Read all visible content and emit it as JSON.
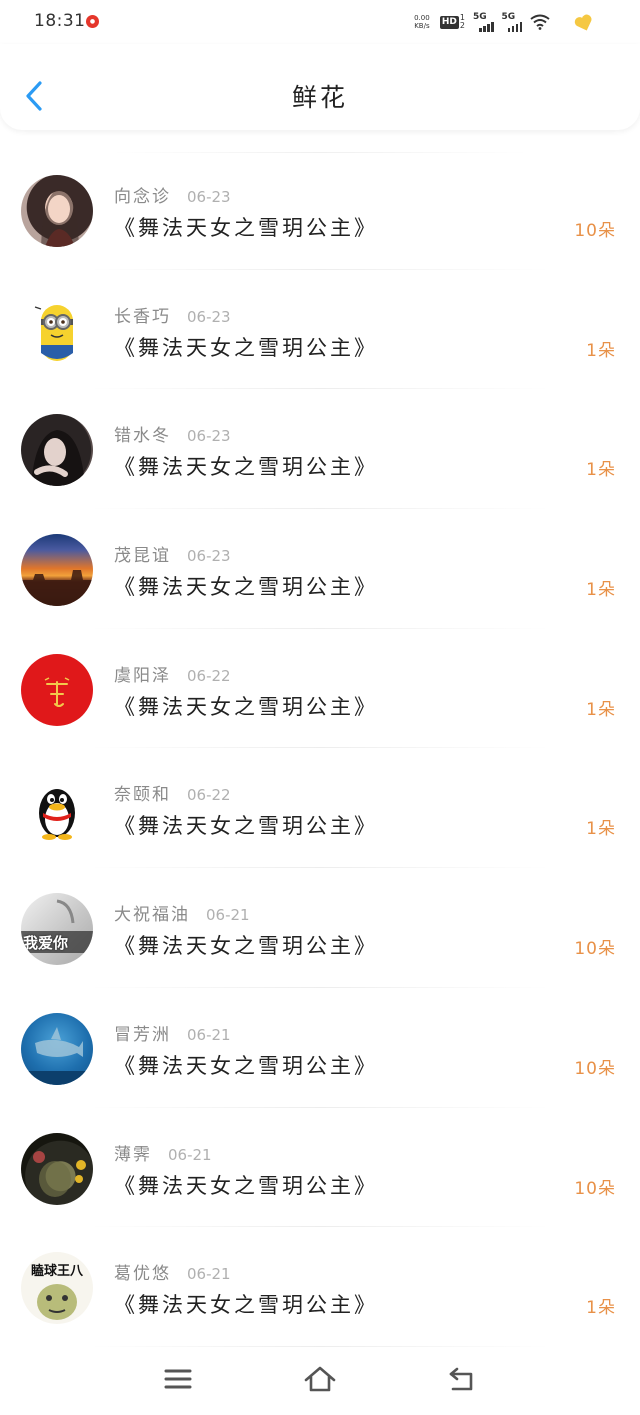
{
  "status_bar": {
    "time": "18:31",
    "speed_value": "0.00",
    "speed_unit": "KB/s",
    "hd_label": "HD",
    "hd_sup": "1",
    "hd_sub": "2",
    "network_1": "5G",
    "network_2": "5G",
    "icons": [
      "notification-badge-icon",
      "wifi-icon",
      "heart-icon"
    ]
  },
  "header": {
    "title": "鲜花",
    "back_icon": "chevron-left-icon"
  },
  "colors": {
    "accent": "#2b9bf4",
    "count": "#e89148",
    "name": "#8a8a8a",
    "date": "#b0b0b0",
    "title": "#222222"
  },
  "gifts": [
    {
      "name": "向念诊",
      "date": "06-23",
      "title": "《舞法天女之雪玥公主》",
      "count": "10朵",
      "avatar": "photo-girl"
    },
    {
      "name": "长香巧",
      "date": "06-23",
      "title": "《舞法天女之雪玥公主》",
      "count": "1朵",
      "avatar": "minion"
    },
    {
      "name": "错水冬",
      "date": "06-23",
      "title": "《舞法天女之雪玥公主》",
      "count": "1朵",
      "avatar": "photo-girl-dark"
    },
    {
      "name": "茂昆谊",
      "date": "06-23",
      "title": "《舞法天女之雪玥公主》",
      "count": "1朵",
      "avatar": "sunset"
    },
    {
      "name": "虞阳泽",
      "date": "06-22",
      "title": "《舞法天女之雪玥公主》",
      "count": "1朵",
      "avatar": "red-logo"
    },
    {
      "name": "奈颐和",
      "date": "06-22",
      "title": "《舞法天女之雪玥公主》",
      "count": "1朵",
      "avatar": "qq-penguin"
    },
    {
      "name": "大祝福油",
      "date": "06-21",
      "title": "《舞法天女之雪玥公主》",
      "count": "10朵",
      "avatar": "grey-text",
      "avatar_text": "我爱你"
    },
    {
      "name": "冒芳洲",
      "date": "06-21",
      "title": "《舞法天女之雪玥公主》",
      "count": "10朵",
      "avatar": "shark"
    },
    {
      "name": "薄霁",
      "date": "06-21",
      "title": "《舞法天女之雪玥公主》",
      "count": "10朵",
      "avatar": "dark-photo"
    },
    {
      "name": "葛优悠",
      "date": "06-21",
      "title": "《舞法天女之雪玥公主》",
      "count": "1朵",
      "avatar": "meme",
      "avatar_text": "瞌球王八"
    }
  ],
  "nav": {
    "icons": [
      "menu-icon",
      "home-icon",
      "back-icon"
    ]
  }
}
